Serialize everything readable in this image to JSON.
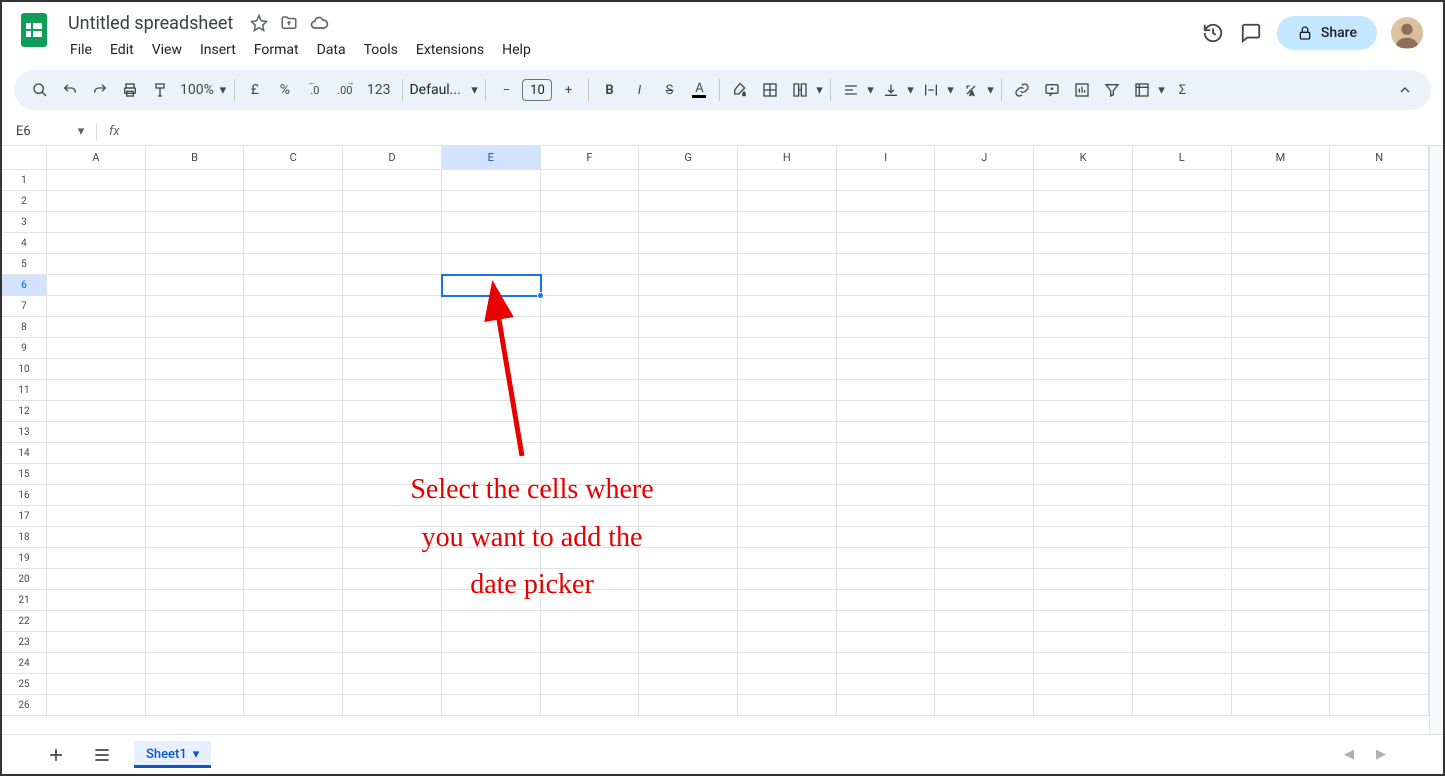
{
  "doc": {
    "title": "Untitled spreadsheet"
  },
  "menus": [
    "File",
    "Edit",
    "View",
    "Insert",
    "Format",
    "Data",
    "Tools",
    "Extensions",
    "Help"
  ],
  "share_label": "Share",
  "toolbar": {
    "zoom": "100%",
    "currency": "£",
    "percent": "%",
    "dec_dec": ".0",
    "inc_dec": ".00",
    "numfmt": "123",
    "font": "Defaul...",
    "fontsize": "10",
    "minus": "−",
    "plus": "+"
  },
  "namebox": {
    "ref": "E6"
  },
  "formula": "",
  "columns": [
    "A",
    "B",
    "C",
    "D",
    "E",
    "F",
    "G",
    "H",
    "I",
    "J",
    "K",
    "L",
    "M",
    "N"
  ],
  "rows": [
    1,
    2,
    3,
    4,
    5,
    6,
    7,
    8,
    9,
    10,
    11,
    12,
    13,
    14,
    15,
    16,
    17,
    18,
    19,
    20,
    21,
    22,
    23,
    24,
    25,
    26
  ],
  "selected": {
    "col": "E",
    "row": 6
  },
  "tabs": {
    "sheet1": "Sheet1"
  },
  "annotation": {
    "line1": "Select the cells where",
    "line2": "you want to add the",
    "line3": "date picker"
  }
}
